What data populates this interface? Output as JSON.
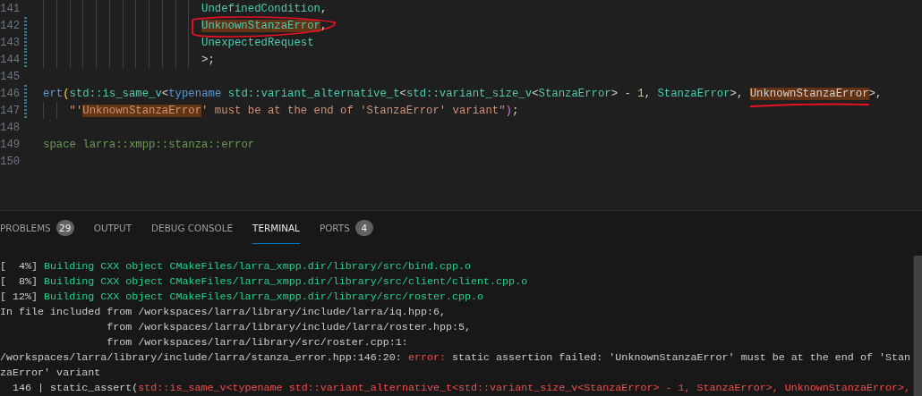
{
  "editor": {
    "lines": [
      {
        "number": "141",
        "modified": false,
        "kind": "deep",
        "tokens": [
          {
            "kind": "type",
            "text": "UndefinedCondition"
          },
          {
            "kind": "plain",
            "text": ","
          }
        ]
      },
      {
        "number": "142",
        "modified": true,
        "kind": "deep",
        "tokens": [
          {
            "kind": "type",
            "text": "UnknownStanzaError",
            "highlighted": true,
            "circled": true
          },
          {
            "kind": "plain",
            "text": ","
          }
        ]
      },
      {
        "number": "143",
        "modified": true,
        "kind": "deep",
        "tokens": [
          {
            "kind": "type",
            "text": "UnexpectedRequest"
          }
        ]
      },
      {
        "number": "144",
        "modified": true,
        "kind": "deep",
        "tokens": [
          {
            "kind": "plain",
            "text": ">;"
          }
        ]
      },
      {
        "number": "145",
        "modified": false
      },
      {
        "number": "146",
        "modified": true,
        "tokens": [
          {
            "kind": "keyword",
            "text": "ert"
          },
          {
            "kind": "paren",
            "text": "("
          },
          {
            "kind": "type",
            "text": "std::is_same_v"
          },
          {
            "kind": "plain",
            "text": "<"
          },
          {
            "kind": "keyword",
            "text": "typename"
          },
          {
            "kind": "type",
            "text": " std::variant_alternative_t"
          },
          {
            "kind": "plain",
            "text": "<"
          },
          {
            "kind": "type",
            "text": "std::variant_size_v"
          },
          {
            "kind": "plain",
            "text": "<"
          },
          {
            "kind": "type",
            "text": "StanzaError"
          },
          {
            "kind": "plain",
            "text": "> - "
          },
          {
            "kind": "number",
            "text": "1"
          },
          {
            "kind": "plain",
            "text": ", "
          },
          {
            "kind": "type",
            "text": "StanzaError"
          },
          {
            "kind": "plain",
            "text": ">, "
          },
          {
            "kind": "plain",
            "text": "UnknownStanzaError",
            "highlighted": true,
            "underlined": true
          },
          {
            "kind": "plain",
            "text": ">,"
          }
        ]
      },
      {
        "number": "147",
        "modified": true,
        "kind": "shallow",
        "tokens": [
          {
            "kind": "string",
            "text": "\"'"
          },
          {
            "kind": "string",
            "text": "UnknownStanzaError",
            "highlighted": true
          },
          {
            "kind": "string",
            "text": "' must be at the end of 'StanzaError' variant\""
          },
          {
            "kind": "paren2",
            "text": ")"
          },
          {
            "kind": "plain",
            "text": ";"
          }
        ]
      },
      {
        "number": "148",
        "modified": false
      },
      {
        "number": "149",
        "modified": false,
        "tokens": [
          {
            "kind": "comment",
            "text": "space larra::xmpp::stanza::error"
          }
        ]
      },
      {
        "number": "150",
        "modified": false
      }
    ]
  },
  "panel": {
    "tabs": [
      {
        "label": "PROBLEMS",
        "badge": "29",
        "selected": false
      },
      {
        "label": "OUTPUT",
        "selected": false
      },
      {
        "label": "DEBUG CONSOLE",
        "selected": false
      },
      {
        "label": "TERMINAL",
        "selected": true
      },
      {
        "label": "PORTS",
        "badge": "4",
        "selected": false
      }
    ],
    "terminal": [
      [
        {
          "kind": "plain",
          "text": "[  4%] "
        },
        {
          "kind": "success",
          "text": "Building CXX object CMakeFiles/larra_xmpp.dir/library/src/bind.cpp.o"
        }
      ],
      [
        {
          "kind": "plain",
          "text": "[  8%] "
        },
        {
          "kind": "success",
          "text": "Building CXX object CMakeFiles/larra_xmpp.dir/library/src/client/client.cpp.o"
        }
      ],
      [
        {
          "kind": "plain",
          "text": "[ 12%] "
        },
        {
          "kind": "success",
          "text": "Building CXX object CMakeFiles/larra_xmpp.dir/library/src/roster.cpp.o"
        }
      ],
      [
        {
          "kind": "plain",
          "text": "In file included from /workspaces/larra/library/include/larra/iq.hpp:6,"
        }
      ],
      [
        {
          "kind": "plain",
          "text": "                 from /workspaces/larra/library/include/larra/roster.hpp:5,"
        }
      ],
      [
        {
          "kind": "plain",
          "text": "                 from /workspaces/larra/library/src/roster.cpp:1:"
        }
      ],
      [
        {
          "kind": "plain",
          "text": "/workspaces/larra/library/include/larra/stanza_error.hpp:146:20: "
        },
        {
          "kind": "error",
          "text": "error:"
        },
        {
          "kind": "plain",
          "text": " static assertion failed: 'UnknownStanzaError' must be at the end of 'Stan"
        }
      ],
      [
        {
          "kind": "plain",
          "text": "zaError' variant"
        }
      ],
      [
        {
          "kind": "plain",
          "text": "  146 | static_assert("
        },
        {
          "kind": "error",
          "text": "std::is_same_v<typename std::variant_alternative_t<std::variant_size_v<StanzaError> - 1, StanzaError>, UnknownStanzaError>,"
        }
      ]
    ]
  }
}
